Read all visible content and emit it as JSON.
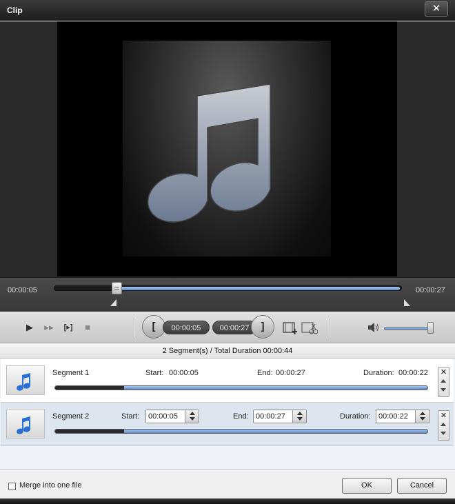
{
  "window": {
    "title": "Clip",
    "close_label": "✕"
  },
  "timeline": {
    "current_time": "00:00:05",
    "end_time": "00:00:27",
    "progress": 0.18
  },
  "controls": {
    "play_icon": "▶",
    "ff_icon": "▶▶",
    "frame_icon": "[▸]",
    "stop_icon": "■",
    "set_start_icon": "[",
    "set_end_icon": "]",
    "start_time": "00:00:05",
    "end_time": "00:00:27",
    "volume_icon": "speaker-icon",
    "volume": 0.9
  },
  "segments_summary": "2 Segment(s) / Total Duration 00:00:44",
  "segments": [
    {
      "name": "Segment 1",
      "start_label": "Start:",
      "start": "00:00:05",
      "end_label": "End:",
      "end": "00:00:27",
      "duration_label": "Duration:",
      "duration": "00:00:22"
    },
    {
      "name": "Segment 2",
      "start_label": "Start:",
      "start": "00:00:05",
      "end_label": "End:",
      "end": "00:00:27",
      "duration_label": "Duration:",
      "duration": "00:00:22"
    }
  ],
  "footer": {
    "merge_label": "Merge into one file",
    "ok_label": "OK",
    "cancel_label": "Cancel"
  },
  "colors": {
    "accent_blue": "#5d88c6",
    "note_blue": "#2a6fd6"
  }
}
